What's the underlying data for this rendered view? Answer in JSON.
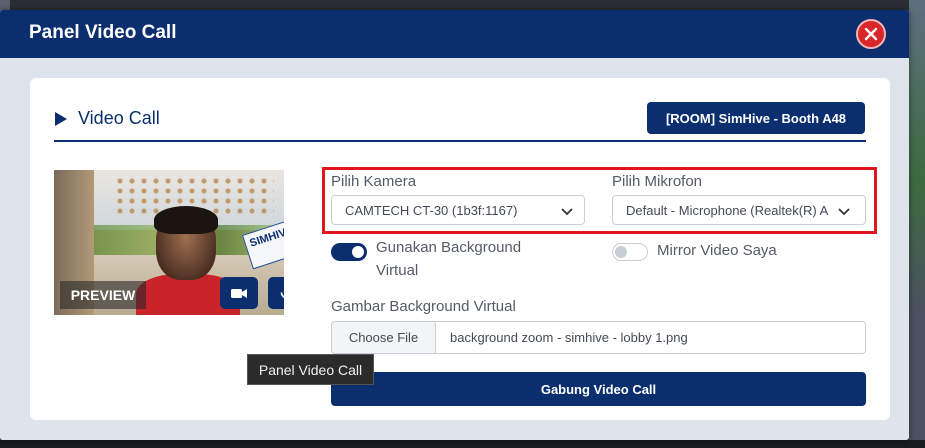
{
  "modal": {
    "title": "Panel Video Call",
    "close_icon": "close-icon"
  },
  "section": {
    "title": "Video Call",
    "icon": "play-icon",
    "room_label": "[ROOM] SimHive - Booth A48"
  },
  "preview": {
    "label": "PREVIEW",
    "sign_text": "SIMHIVE",
    "camera_icon": "video-camera-icon",
    "mic_icon": "microphone-icon"
  },
  "camera": {
    "label": "Pilih Kamera",
    "selected": "CAMTECH CT-30 (1b3f:1167)"
  },
  "microphone": {
    "label": "Pilih Mikrofon",
    "selected": "Default - Microphone (Realtek(R) A"
  },
  "virtual_bg_toggle": {
    "line1": "Gunakan Background",
    "line2": "Virtual",
    "on": true
  },
  "mirror_toggle": {
    "label": "Mirror Video Saya",
    "on": false
  },
  "background_file": {
    "label": "Gambar Background Virtual",
    "button": "Choose File",
    "filename": "background zoom - simhive - lobby 1.png"
  },
  "join_button": "Gabung Video Call",
  "tooltip": "Panel Video Call",
  "colors": {
    "primary": "#0b2e6e",
    "close": "#d9262b",
    "highlight": "#e0161b"
  }
}
